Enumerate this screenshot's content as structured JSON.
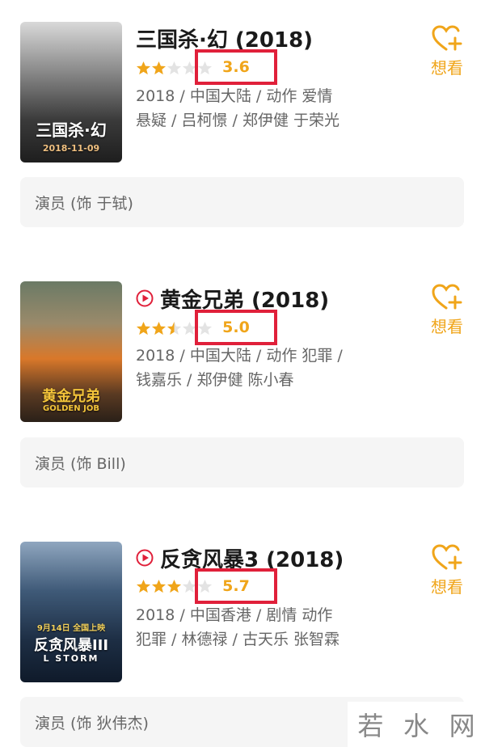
{
  "movies": [
    {
      "title": "三国杀·幻 (2018)",
      "has_play_icon": false,
      "stars_full": 2,
      "stars_half": 0,
      "score": "3.6",
      "meta_line1": "2018 / 中国大陆 / 动作 爱情",
      "meta_line2": "悬疑 / 吕柯憬 / 郑伊健 于荣光",
      "want_label": "想看",
      "role": "演员 (饰 于轼)",
      "poster_caption": "三国杀·幻",
      "poster_date": "2018-11-09"
    },
    {
      "title": "黄金兄弟 (2018)",
      "has_play_icon": true,
      "stars_full": 2,
      "stars_half": 1,
      "score": "5.0",
      "meta_line1": "2018 / 中国大陆 / 动作 犯罪 /",
      "meta_line2": "钱嘉乐 / 郑伊健 陈小春",
      "want_label": "想看",
      "role": "演员 (饰 Bill)",
      "poster_caption": "黄金兄弟",
      "poster_sub": "GOLDEN JOB"
    },
    {
      "title": "反贪风暴3 (2018)",
      "has_play_icon": true,
      "stars_full": 3,
      "stars_half": 0,
      "score": "5.7",
      "meta_line1": "2018 / 中国香港 / 剧情 动作",
      "meta_line2": "犯罪 / 林德禄 / 古天乐 张智霖",
      "want_label": "想看",
      "role": "演员 (饰 狄伟杰)",
      "poster_caption": "反贪风暴III",
      "poster_sub": "L STORM",
      "poster_date": "9月14日 全国上映"
    }
  ],
  "watermark": [
    "若",
    "水",
    "网"
  ],
  "colors": {
    "accent": "#f0a51a",
    "highlight_box": "#e0203a",
    "play": "#e0203a"
  }
}
